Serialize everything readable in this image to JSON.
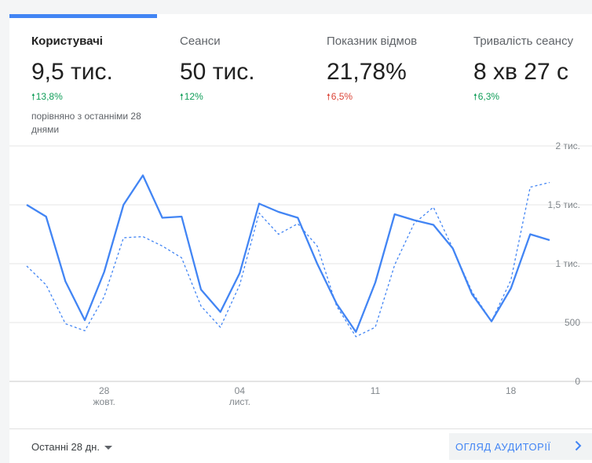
{
  "metrics": [
    {
      "label": "Користувачі",
      "value": "9,5 тис.",
      "change": "13,8%",
      "direction": "up",
      "compare": "порівняно з останніми 28 днями"
    },
    {
      "label": "Сеанси",
      "value": "50 тис.",
      "change": "12%",
      "direction": "up"
    },
    {
      "label": "Показник відмов",
      "value": "21,78%",
      "change": "6,5%",
      "direction": "up-bad"
    },
    {
      "label": "Тривалість сеансу",
      "value": "8 хв 27 с",
      "change": "6,3%",
      "direction": "up"
    }
  ],
  "colors": {
    "accent": "#4285f4",
    "positive": "#0f9d58",
    "negative": "#db4437"
  },
  "chart_data": {
    "type": "line",
    "y_ticks": [
      "2 тис.",
      "1,5 тис.",
      "1 тис.",
      "500",
      "0"
    ],
    "ylim": [
      0,
      2000
    ],
    "x_ticks": [
      {
        "day": "28",
        "month": "жовт.",
        "index": 4
      },
      {
        "day": "04",
        "month": "лист.",
        "index": 11
      },
      {
        "day": "11",
        "month": "",
        "index": 18
      },
      {
        "day": "18",
        "month": "",
        "index": 25
      }
    ],
    "series": [
      {
        "style": "solid",
        "values": [
          1500,
          1400,
          850,
          520,
          930,
          1500,
          1750,
          1390,
          1400,
          780,
          590,
          920,
          1510,
          1440,
          1390,
          1000,
          660,
          420,
          840,
          1420,
          1370,
          1330,
          1130,
          740,
          510,
          790,
          1250,
          1200
        ]
      },
      {
        "style": "dashed",
        "values": [
          980,
          820,
          490,
          430,
          720,
          1220,
          1230,
          1150,
          1050,
          640,
          460,
          820,
          1430,
          1250,
          1340,
          1150,
          640,
          380,
          460,
          990,
          1340,
          1480,
          1130,
          760,
          510,
          860,
          1650,
          1690
        ]
      }
    ]
  },
  "footer": {
    "range_label": "Останні 28 дн.",
    "overview_label": "ОГЛЯД АУДИТОРІЇ"
  }
}
